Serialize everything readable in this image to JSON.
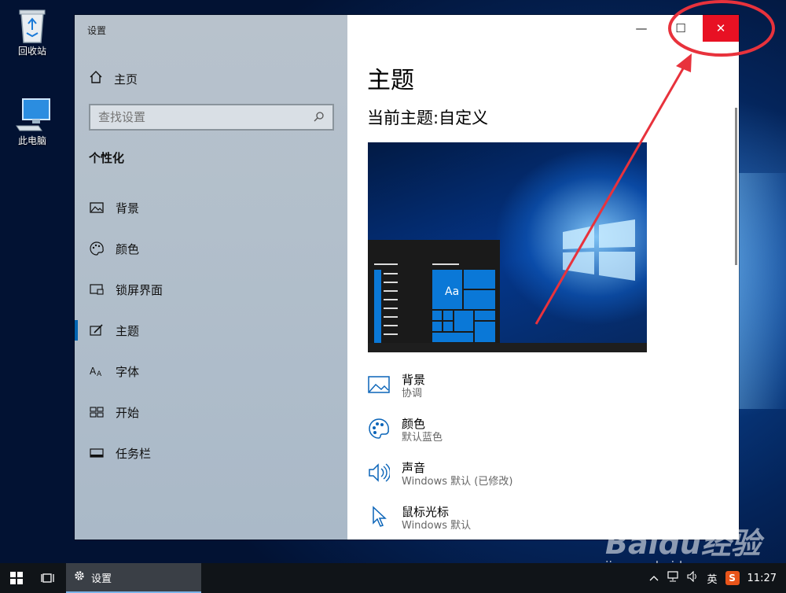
{
  "desktop": {
    "icons": [
      {
        "label": "回收站",
        "icon": "recycle-bin-icon"
      },
      {
        "label": "此电脑",
        "icon": "computer-icon"
      }
    ]
  },
  "window": {
    "title": "设置",
    "caption": {
      "minimize": "—",
      "maximize": "☐",
      "close": "✕"
    }
  },
  "sidebar": {
    "home_label": "主页",
    "search_placeholder": "查找设置",
    "section_title": "个性化",
    "items": [
      {
        "label": "背景",
        "icon": "picture-icon"
      },
      {
        "label": "颜色",
        "icon": "palette-icon"
      },
      {
        "label": "锁屏界面",
        "icon": "lock-screen-icon"
      },
      {
        "label": "主题",
        "icon": "theme-brush-icon",
        "active": true
      },
      {
        "label": "字体",
        "icon": "font-icon"
      },
      {
        "label": "开始",
        "icon": "start-tiles-icon"
      },
      {
        "label": "任务栏",
        "icon": "taskbar-icon"
      }
    ]
  },
  "main": {
    "title": "主题",
    "current_theme": "当前主题:自定义",
    "preview_text": "Aa",
    "settings": [
      {
        "title": "背景",
        "value": "协调",
        "icon": "picture-icon"
      },
      {
        "title": "颜色",
        "value": "默认蓝色",
        "icon": "palette-icon"
      },
      {
        "title": "声音",
        "value": "Windows 默认 (已修改)",
        "icon": "speaker-icon"
      },
      {
        "title": "鼠标光标",
        "value": "Windows 默认",
        "icon": "cursor-icon"
      }
    ]
  },
  "taskbar": {
    "app_label": "设置",
    "ime": "英",
    "ime_logo": "S",
    "time": "11:27"
  },
  "watermark": {
    "logo": "Baidu经验",
    "url": "jingyan.baidu.com"
  },
  "colors": {
    "accent": "#0063b1",
    "close_red": "#e81123",
    "annotation_red": "#e8323c"
  }
}
